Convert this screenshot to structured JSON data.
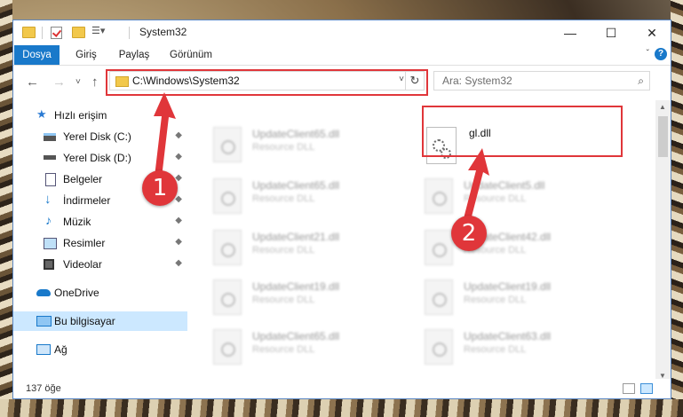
{
  "window": {
    "title": "System32"
  },
  "ribbon": {
    "tabs": [
      "Dosya",
      "Giriş",
      "Paylaş",
      "Görünüm"
    ],
    "help_glyph": "?",
    "collapse_glyph": "ˇ"
  },
  "titlebar_buttons": {
    "minimize": "—",
    "maximize": "☐",
    "close": "✕"
  },
  "nav": {
    "back": "←",
    "forward": "→",
    "recent": "˅",
    "up": "↑"
  },
  "address": {
    "path": "C:\\Windows\\System32",
    "dropdown": "˅",
    "refresh": "↻"
  },
  "search": {
    "placeholder": "Ara: System32",
    "icon": "⌕"
  },
  "sidebar": {
    "quick_access": "Hızlı erişim",
    "items": [
      {
        "label": "Yerel Disk (C:)",
        "icon": "drive-icon",
        "pinned": true
      },
      {
        "label": "Yerel Disk (D:)",
        "icon": "drive-icon",
        "pinned": true
      },
      {
        "label": "Belgeler",
        "icon": "documents-icon",
        "pinned": true
      },
      {
        "label": "İndirmeler",
        "icon": "download-icon",
        "pinned": true
      },
      {
        "label": "Müzik",
        "icon": "music-icon",
        "pinned": true
      },
      {
        "label": "Resimler",
        "icon": "pictures-icon",
        "pinned": true
      },
      {
        "label": "Videolar",
        "icon": "videos-icon",
        "pinned": true
      }
    ],
    "onedrive": "OneDrive",
    "this_pc": "Bu bilgisayar",
    "network": "Ağ",
    "pin_glyph": "◆"
  },
  "files": [
    {
      "name": "UpdateClient65.dll",
      "type": "Resource DLL"
    },
    {
      "name": "gl.dll",
      "type": ""
    },
    {
      "name": "UpdateClient65.dll",
      "type": "Resource DLL"
    },
    {
      "name": "UpdateClient5.dll",
      "type": "Resource DLL"
    },
    {
      "name": "UpdateClient21.dll",
      "type": "Resource DLL"
    },
    {
      "name": "UpdateClient42.dll",
      "type": "Resource DLL"
    },
    {
      "name": "UpdateClient19.dll",
      "type": "Resource DLL"
    },
    {
      "name": "UpdateClient19.dll",
      "type": "Resource DLL"
    },
    {
      "name": "UpdateClient65.dll",
      "type": "Resource DLL"
    },
    {
      "name": "UpdateClient63.dll",
      "type": "Resource DLL"
    }
  ],
  "status": {
    "item_count": "137 öğe"
  },
  "annotations": {
    "badge_1": "1",
    "badge_2": "2",
    "color": "#e0363a"
  },
  "colors": {
    "accent": "#1979ca",
    "selection": "#cce8ff"
  }
}
